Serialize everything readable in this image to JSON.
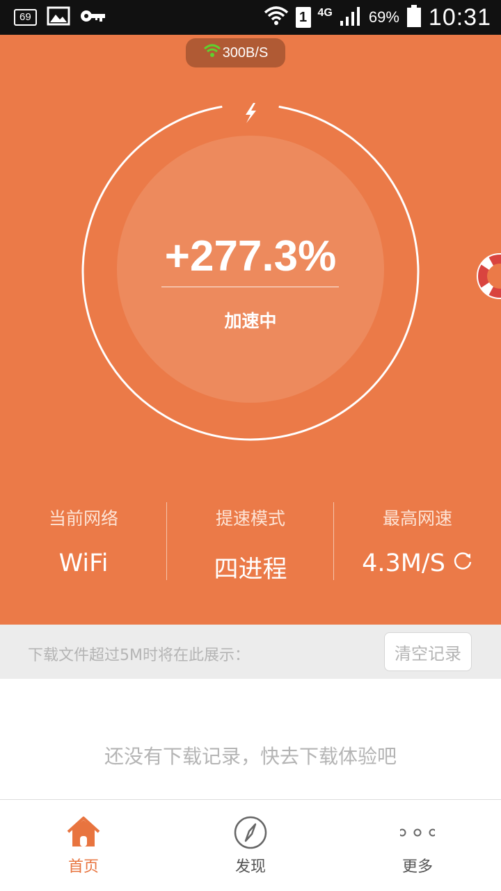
{
  "status_bar": {
    "notification_count": "69",
    "sim_slot": "1",
    "network_type": "4G",
    "battery": "69%",
    "time": "10:31"
  },
  "hero": {
    "current_speed": "300B/S",
    "boost_percent": "+277.3%",
    "status": "加速中"
  },
  "stats": [
    {
      "label": "当前网络",
      "value": "WiFi"
    },
    {
      "label": "提速模式",
      "value": "四进程"
    },
    {
      "label": "最高网速",
      "value": "4.3M/S"
    }
  ],
  "downloads": {
    "notice": "下载文件超过5M时将在此展示：",
    "clear_label": "清空记录",
    "empty_message": "还没有下载记录，快去下载体验吧"
  },
  "tabs": [
    {
      "label": "首页",
      "icon": "home-icon",
      "active": true
    },
    {
      "label": "发现",
      "icon": "compass-icon",
      "active": false
    },
    {
      "label": "更多",
      "icon": "more-icon",
      "active": false
    }
  ],
  "colors": {
    "accent": "#eb7a48",
    "pill": "#b05a34",
    "active_tab": "#e8743f",
    "wifi_green": "#5fd12e"
  }
}
